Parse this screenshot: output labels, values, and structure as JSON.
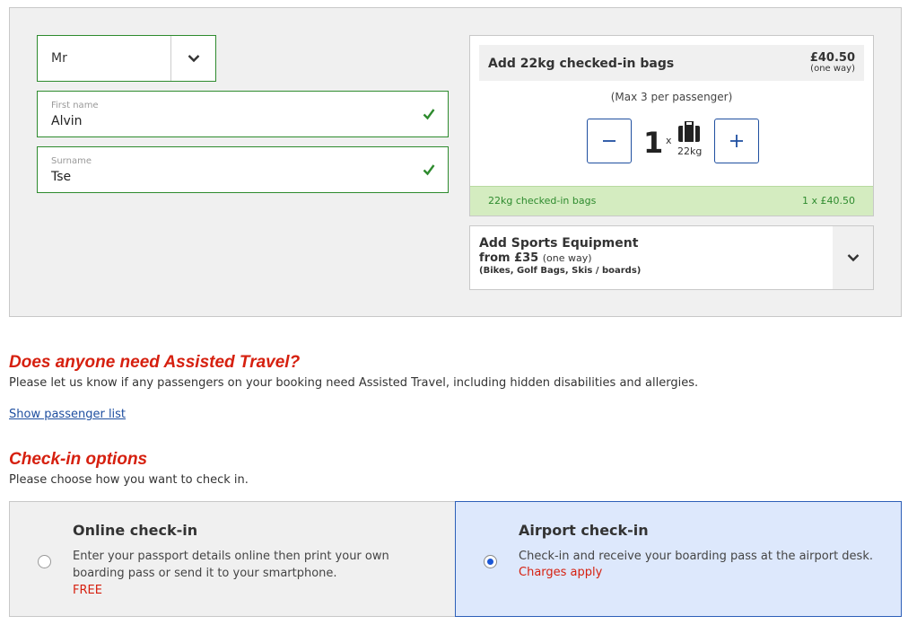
{
  "passenger": {
    "title_value": "Mr",
    "first_name_label": "First name",
    "first_name_value": "Alvin",
    "surname_label": "Surname",
    "surname_value": "Tse"
  },
  "bags": {
    "title": "Add 22kg checked-in bags",
    "price": "£40.50",
    "price_note": "(one way)",
    "max_note": "(Max 3 per passenger)",
    "quantity": "1",
    "times": "x",
    "bag_weight": "22kg",
    "summary_label": "22kg checked-in bags",
    "summary_value": "1 x £40.50"
  },
  "sports": {
    "title": "Add Sports Equipment",
    "from_price": "from £35",
    "from_note": "(one way)",
    "items": "(Bikes, Golf Bags, Skis / boards)"
  },
  "assisted": {
    "heading": "Does anyone need Assisted Travel?",
    "text": "Please let us know if any passengers on your booking need Assisted Travel, including hidden disabilities and allergies.",
    "link": "Show passenger list"
  },
  "checkin": {
    "heading": "Check-in options",
    "text": "Please choose how you want to check in.",
    "options": [
      {
        "title": "Online check-in",
        "desc": "Enter your passport details online then print your own boarding pass or send it to your smartphone.",
        "extra": "FREE",
        "selected": false
      },
      {
        "title": "Airport check-in",
        "desc": "Check-in and receive your boarding pass at the airport desk.",
        "extra": "Charges apply",
        "selected": true
      }
    ]
  },
  "colors": {
    "accent_red": "#d6200f",
    "valid_green": "#2e8b2e",
    "link_blue": "#1f4fa0",
    "selected_bg": "#dde8fc"
  }
}
